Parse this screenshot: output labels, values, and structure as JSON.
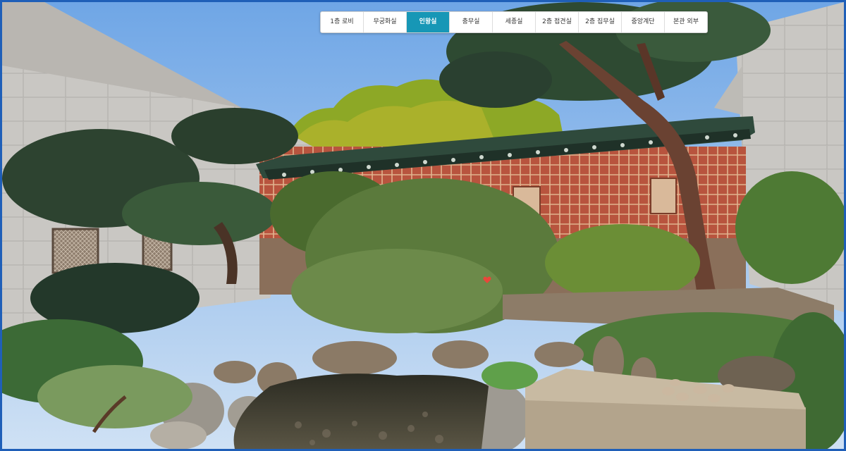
{
  "nav": {
    "tabs": [
      {
        "label": "1층 로비",
        "active": false
      },
      {
        "label": "무궁화실",
        "active": false
      },
      {
        "label": "인왕실",
        "active": true
      },
      {
        "label": "충무실",
        "active": false
      },
      {
        "label": "세종실",
        "active": false
      },
      {
        "label": "2층 접견실",
        "active": false
      },
      {
        "label": "2층 집무실",
        "active": false
      },
      {
        "label": "중앙계단",
        "active": false
      },
      {
        "label": "본관 외부",
        "active": false
      }
    ]
  },
  "hotspot": {
    "icon": "heart-icon",
    "color": "#e8473a"
  },
  "colors": {
    "active_tab": "#1797b6",
    "frame_border": "#1f5fb8"
  }
}
